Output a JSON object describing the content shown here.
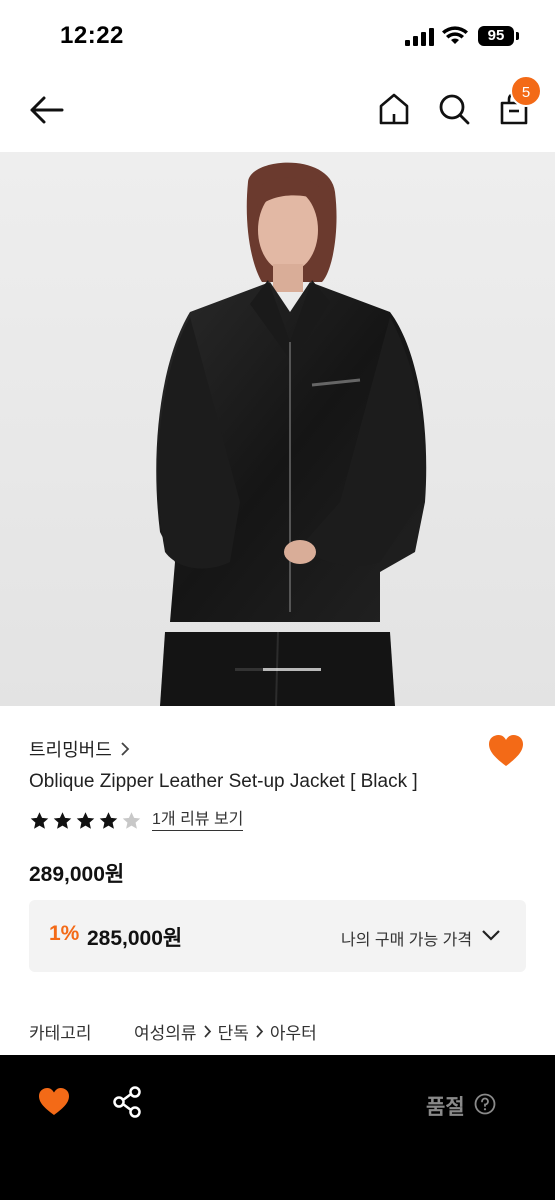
{
  "status_bar": {
    "time": "12:22",
    "battery": "95"
  },
  "header": {
    "cart_count": "5",
    "icons": [
      "back-arrow-icon",
      "home-icon",
      "search-icon",
      "shopping-bag-icon"
    ]
  },
  "product": {
    "image_description": "model-in-black-leather-jacket",
    "brand": "트리밍버드",
    "title": "Oblique Zipper Leather Set-up Jacket [ Black ]",
    "rating": 4,
    "rating_max": 5,
    "review_link": "1개 리뷰 보기",
    "price": "289,000원",
    "discount_rate": "1%",
    "discount_price": "285,000원",
    "my_price_label": "나의 구매 가능 가격",
    "category_label": "카테고리",
    "category_path": [
      "여성의류",
      "단독",
      "아우터"
    ]
  },
  "bottom_bar": {
    "status_label": "품절"
  },
  "colors": {
    "accent": "#f36a17",
    "bottom_bar": "#000000",
    "discount_bg": "#f3f3f3"
  }
}
